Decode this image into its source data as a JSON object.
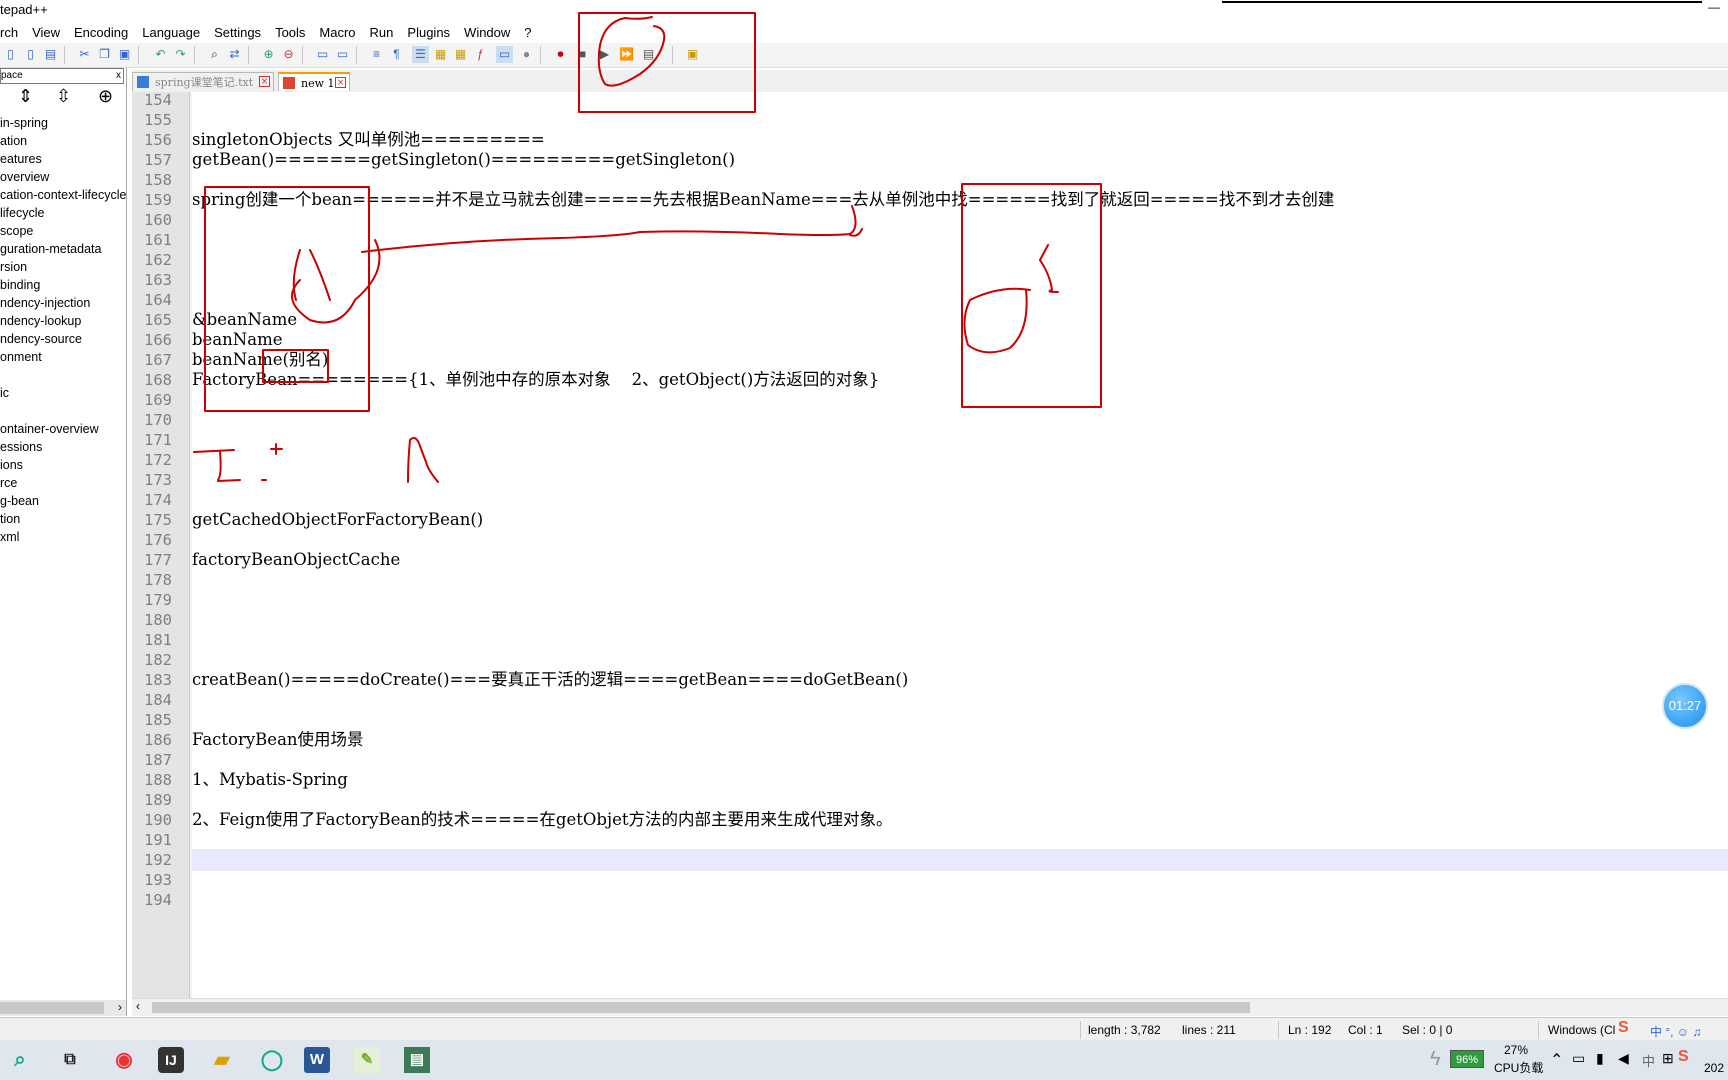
{
  "window": {
    "title": "tepad++",
    "controls": "—"
  },
  "menu": [
    "rch",
    "View",
    "Encoding",
    "Language",
    "Settings",
    "Tools",
    "Macro",
    "Run",
    "Plugins",
    "Window",
    "?"
  ],
  "side_panel": {
    "header": "pace",
    "close": "x",
    "items": [
      "in-spring",
      "ation",
      "eatures",
      "overview",
      "cation-context-lifecycle",
      "lifecycle",
      "scope",
      "guration-metadata",
      "rsion",
      "binding",
      "ndency-injection",
      "ndency-lookup",
      "ndency-source",
      "onment",
      "",
      "ic",
      "",
      "ontainer-overview",
      "essions",
      "ions",
      "rce",
      "g-bean",
      "tion",
      "xml"
    ]
  },
  "tabs": [
    {
      "label": "spring课堂笔记.txt",
      "active": false
    },
    {
      "label": "new 1",
      "active": true
    }
  ],
  "editor": {
    "lines": [
      {
        "n": "154",
        "text": ""
      },
      {
        "n": "155",
        "text": ""
      },
      {
        "n": "156",
        "text": "singletonObjects 又叫单例池========="
      },
      {
        "n": "157",
        "text": "getBean()=======getSingleton()=========getSingleton()"
      },
      {
        "n": "158",
        "text": ""
      },
      {
        "n": "159",
        "text": "spring创建一个bean======并不是立马就去创建=====先去根据BeanName===去从单例池中找======找到了就返回=====找不到才去创建"
      },
      {
        "n": "160",
        "text": ""
      },
      {
        "n": "161",
        "text": ""
      },
      {
        "n": "162",
        "text": ""
      },
      {
        "n": "163",
        "text": ""
      },
      {
        "n": "164",
        "text": ""
      },
      {
        "n": "165",
        "text": "&beanName"
      },
      {
        "n": "166",
        "text": "beanName"
      },
      {
        "n": "167",
        "text": "beanName(别名)"
      },
      {
        "n": "168",
        "text": "FactoryBean========{1、单例池中存的原本对象    2、getObject()方法返回的对象}"
      },
      {
        "n": "169",
        "text": ""
      },
      {
        "n": "170",
        "text": ""
      },
      {
        "n": "171",
        "text": ""
      },
      {
        "n": "172",
        "text": ""
      },
      {
        "n": "173",
        "text": ""
      },
      {
        "n": "174",
        "text": ""
      },
      {
        "n": "175",
        "text": "getCachedObjectForFactoryBean()"
      },
      {
        "n": "176",
        "text": ""
      },
      {
        "n": "177",
        "text": "factoryBeanObjectCache"
      },
      {
        "n": "178",
        "text": ""
      },
      {
        "n": "179",
        "text": ""
      },
      {
        "n": "180",
        "text": ""
      },
      {
        "n": "181",
        "text": ""
      },
      {
        "n": "182",
        "text": ""
      },
      {
        "n": "183",
        "text": "creatBean()=====doCreate()===要真正干活的逻辑====getBean====doGetBean()"
      },
      {
        "n": "184",
        "text": ""
      },
      {
        "n": "185",
        "text": ""
      },
      {
        "n": "186",
        "text": "FactoryBean使用场景"
      },
      {
        "n": "187",
        "text": ""
      },
      {
        "n": "188",
        "text": "1、Mybatis-Spring"
      },
      {
        "n": "189",
        "text": ""
      },
      {
        "n": "190",
        "text": "2、Feign使用了FactoryBean的技术=====在getObjet方法的内部主要用来生成代理对象。"
      },
      {
        "n": "191",
        "text": ""
      },
      {
        "n": "192",
        "text": ""
      },
      {
        "n": "193",
        "text": ""
      },
      {
        "n": "194",
        "text": ""
      }
    ],
    "current_line": "192"
  },
  "statusbar": {
    "length": "length : 3,782",
    "lines": "lines : 211",
    "ln": "Ln : 192",
    "col": "Col : 1",
    "sel": "Sel : 0 | 0",
    "eol": "Windows (Cl"
  },
  "timer": "01:27",
  "taskbar": {
    "battery": "96%",
    "cpu_percent": "27%",
    "cpu_label": "CPU负载",
    "ime": "中",
    "date_partial": "202"
  },
  "colors": {
    "annotation": "#cc0000",
    "current_line": "#e8e8ff",
    "gutter": "#e4e4e4"
  }
}
